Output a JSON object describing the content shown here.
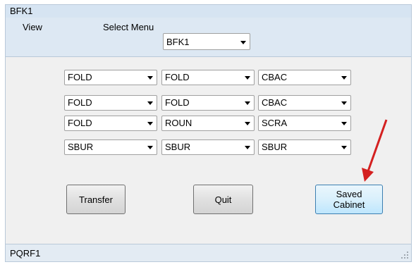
{
  "window": {
    "title": "BFK1"
  },
  "toolbar": {
    "view_label": "View",
    "select_menu_label": "Select Menu",
    "select_menu_value": "BFK1"
  },
  "combos": [
    [
      "FOLD",
      "FOLD",
      "CBAC"
    ],
    [
      "FOLD",
      "FOLD",
      "CBAC"
    ],
    [
      "FOLD",
      "ROUN",
      "SCRA"
    ],
    [
      "SBUR",
      "SBUR",
      "SBUR"
    ]
  ],
  "buttons": {
    "transfer": "Transfer",
    "quit": "Quit",
    "saved_line1": "Saved",
    "saved_line2": "Cabinet"
  },
  "status": {
    "text": "PQRF1"
  },
  "colors": {
    "annotation_arrow": "#d42020"
  }
}
